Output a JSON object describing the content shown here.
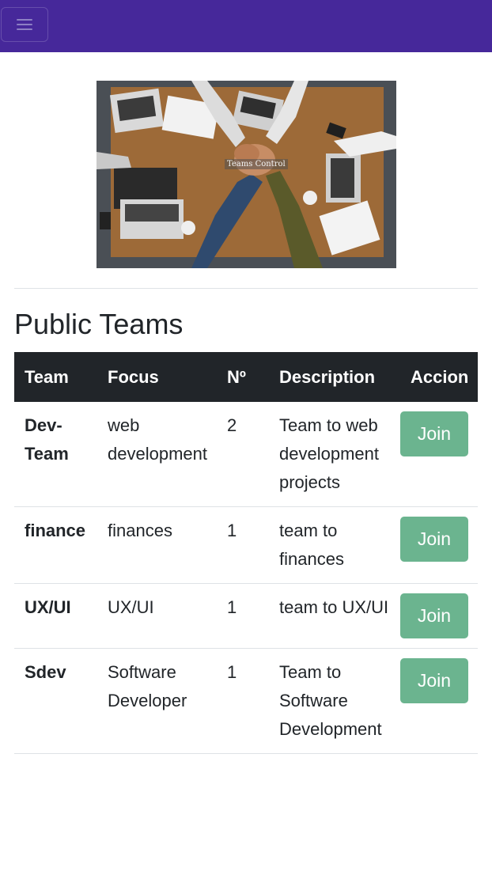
{
  "navbar": {
    "bg_color": "#46289a",
    "toggler_icon": "hamburger-menu-icon"
  },
  "hero": {
    "caption": "Teams Control"
  },
  "section": {
    "title": "Public Teams"
  },
  "table": {
    "headers": [
      "Team",
      "Focus",
      "Nº",
      "Description",
      "Accion"
    ],
    "rows": [
      {
        "team": "Dev-Team",
        "focus": "web development",
        "n": "2",
        "description": "Team to web development projects",
        "action": "Join"
      },
      {
        "team": "finance",
        "focus": "finances",
        "n": "1",
        "description": "team to finances",
        "action": "Join"
      },
      {
        "team": "UX/UI",
        "focus": "UX/UI",
        "n": "1",
        "description": "team to UX/UI",
        "action": "Join"
      },
      {
        "team": "Sdev",
        "focus": "Software Developer",
        "n": "1",
        "description": "Team to Software Development",
        "action": "Join"
      }
    ]
  },
  "colors": {
    "header_bg": "#212529",
    "join_button": "#6bb48f"
  }
}
